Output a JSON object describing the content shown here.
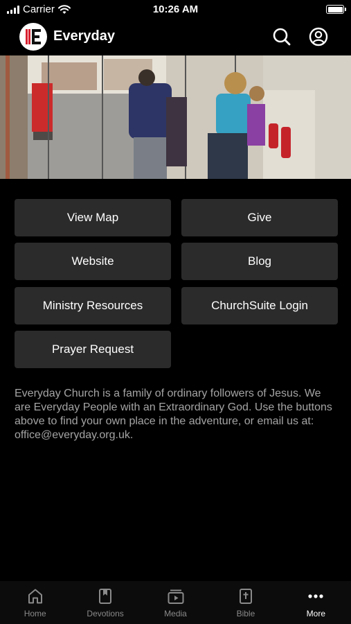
{
  "status_bar": {
    "carrier": "Carrier",
    "time": "10:26 AM"
  },
  "header": {
    "title": "Everyday",
    "icons": {
      "search": "search-icon",
      "account": "account-icon"
    }
  },
  "hero": {
    "image": "church-entrance-photo"
  },
  "buttons": [
    {
      "label": "View Map"
    },
    {
      "label": "Give"
    },
    {
      "label": "Website"
    },
    {
      "label": "Blog"
    },
    {
      "label": "Ministry Resources"
    },
    {
      "label": "ChurchSuite Login"
    },
    {
      "label": "Prayer Request"
    }
  ],
  "description": "Everyday Church is a family of ordinary followers of Jesus. We are Everyday People with an Extraordinary God. Use the buttons above to find your own place in the adventure, or email us at:  office@everyday.org.uk.",
  "tabs": [
    {
      "label": "Home",
      "icon": "home-icon",
      "active": false
    },
    {
      "label": "Devotions",
      "icon": "bookmark-book-icon",
      "active": false
    },
    {
      "label": "Media",
      "icon": "media-play-icon",
      "active": false
    },
    {
      "label": "Bible",
      "icon": "bible-icon",
      "active": false
    },
    {
      "label": "More",
      "icon": "more-dots-icon",
      "active": true
    }
  ],
  "colors": {
    "background": "#000000",
    "button": "#2b2b2b",
    "description_text": "#a4a4a4",
    "inactive_tab": "#8a8a8a"
  }
}
